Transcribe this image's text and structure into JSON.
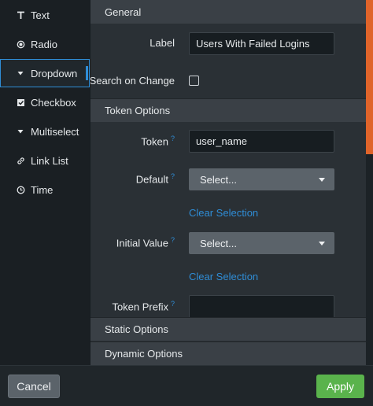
{
  "sidebar": {
    "items": [
      {
        "label": "Text",
        "icon": "text-t-icon"
      },
      {
        "label": "Radio",
        "icon": "radio-icon"
      },
      {
        "label": "Dropdown",
        "icon": "caret-down-icon",
        "selected": true
      },
      {
        "label": "Checkbox",
        "icon": "checkbox-icon"
      },
      {
        "label": "Multiselect",
        "icon": "caret-down-icon"
      },
      {
        "label": "Link List",
        "icon": "link-icon"
      },
      {
        "label": "Time",
        "icon": "clock-icon"
      }
    ]
  },
  "general": {
    "heading": "General",
    "label_label": "Label",
    "label_value": "Users With Failed Logins",
    "search_on_change_label": "Search on Change",
    "search_on_change_checked": false
  },
  "token_options": {
    "heading": "Token Options",
    "token_label": "Token",
    "token_value": "user_name",
    "default_label": "Default",
    "default_value": "Select...",
    "clear_selection_1": "Clear Selection",
    "initial_value_label": "Initial Value",
    "initial_value_value": "Select...",
    "clear_selection_2": "Clear Selection",
    "token_prefix_label": "Token Prefix",
    "help_mark": "?"
  },
  "static_options": {
    "heading": "Static Options"
  },
  "dynamic_options": {
    "heading": "Dynamic Options"
  },
  "footer": {
    "cancel_label": "Cancel",
    "apply_label": "Apply"
  },
  "colors": {
    "accent": "#2f8dd6",
    "apply": "#5ab34c",
    "scrollbar": "#e0642a"
  }
}
